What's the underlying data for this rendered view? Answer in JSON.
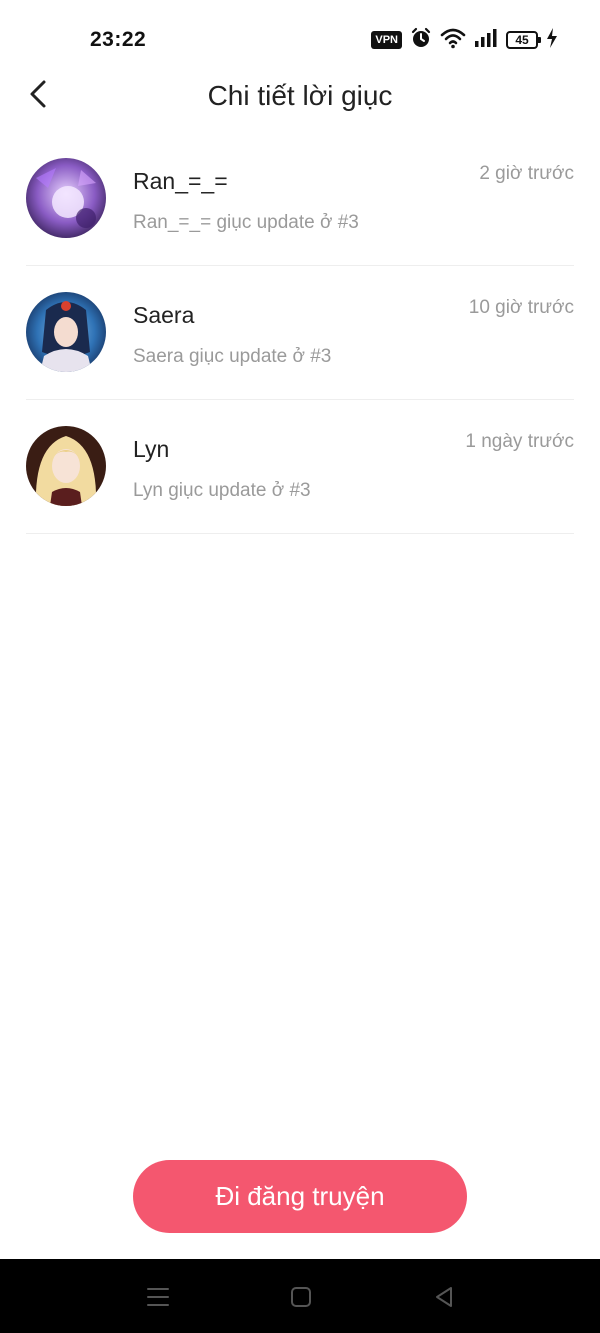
{
  "status_bar": {
    "time": "23:22",
    "vpn_label": "VPN",
    "battery_level": "45",
    "icons": [
      "vpn-icon",
      "alarm-icon",
      "wifi-icon",
      "signal-icon",
      "battery-icon",
      "charging-icon"
    ]
  },
  "header": {
    "title": "Chi tiết lời giục",
    "back_icon": "chevron-left-icon"
  },
  "list": {
    "items": [
      {
        "name": "Ran_=_=",
        "description": "Ran_=_= giục update ở #3",
        "time": "2 giờ trước",
        "avatar_colors": [
          "#5b3a8a",
          "#c7a3e6"
        ]
      },
      {
        "name": "Saera",
        "description": "Saera giục update ở #3",
        "time": "10 giờ trước",
        "avatar_colors": [
          "#2c6fb3",
          "#1a2a55"
        ]
      },
      {
        "name": "Lyn",
        "description": "Lyn giục update ở #3",
        "time": "1 ngày trước",
        "avatar_colors": [
          "#f2d99a",
          "#4a2a1e"
        ]
      }
    ]
  },
  "cta": {
    "label": "Đi đăng truyện",
    "color": "#f4576f"
  },
  "nav_bar": {
    "icons": [
      "menu-icon",
      "home-icon",
      "back-triangle-icon"
    ]
  }
}
